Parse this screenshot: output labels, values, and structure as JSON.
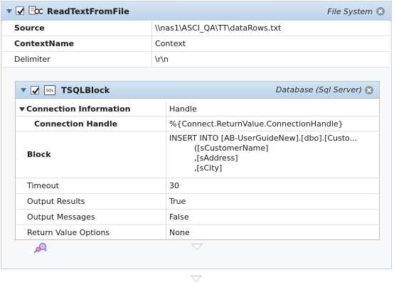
{
  "outer_activity": {
    "title": "ReadTextFromFile",
    "category": "File System",
    "checked": true,
    "properties": [
      {
        "label": "Source",
        "value": "\\\\nas1\\ASCI_QA\\TT\\dataRows.txt"
      },
      {
        "label": "ContextName",
        "value": "Context"
      },
      {
        "label": "Delimiter",
        "value": "\\r\\n"
      }
    ]
  },
  "inner_activity": {
    "title": "TSQLBlock",
    "category": "Database (Sql Server)",
    "checked": true,
    "properties": [
      {
        "label": "Connection Information",
        "value": "Handle"
      },
      {
        "label": "Connection Handle",
        "value": "%{Connect.ReturnValue.ConnectionHandle}"
      },
      {
        "label": "Block",
        "value": "INSERT INTO [AB-UserGuideNew].[dbo].[Custo...\n          ([sCustomerName]\n          ,[sAddress]\n          ,[sCity]"
      },
      {
        "label": "Timeout",
        "value": "30"
      },
      {
        "label": "Output Results",
        "value": "True"
      },
      {
        "label": "Output Messages",
        "value": "False"
      },
      {
        "label": "Return Value Options",
        "value": "None"
      }
    ]
  },
  "colors": {
    "header_top": "#d5e5f4",
    "header_bottom": "#bcd3ea",
    "border": "#c9d3dc"
  }
}
